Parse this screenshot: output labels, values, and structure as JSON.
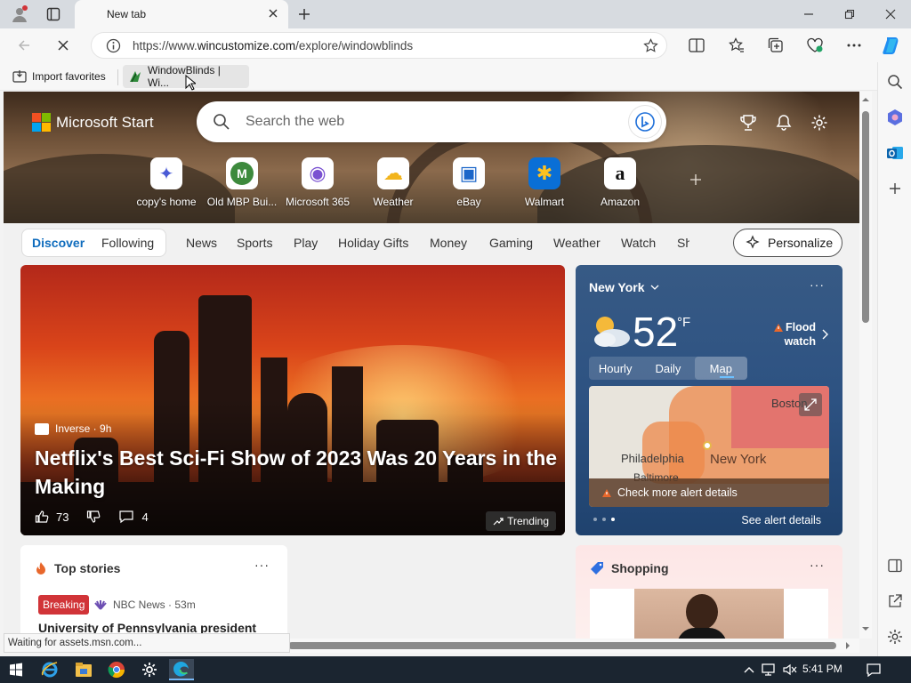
{
  "window": {
    "tab_title": "New tab"
  },
  "toolbar": {
    "url_prefix": "https://www.",
    "url_host": "wincustomize.com",
    "url_path": "/explore/windowblinds"
  },
  "favorites": [
    {
      "label": "Import favorites"
    },
    {
      "label": "WindowBlinds | Wi..."
    }
  ],
  "hero": {
    "brand": "Microsoft Start",
    "search_placeholder": "Search the web",
    "quick_links": [
      {
        "label": "copy's home",
        "color": "#4a5bd6",
        "glyph": "✦"
      },
      {
        "label": "Old MBP Bui...",
        "color": "#3d8a3d",
        "glyph": "M"
      },
      {
        "label": "Microsoft 365",
        "color": "#7a52d1",
        "glyph": "◉"
      },
      {
        "label": "Weather",
        "color": "#f2b41c",
        "glyph": "☁"
      },
      {
        "label": "eBay",
        "color": "#1b66c9",
        "glyph": "▣"
      },
      {
        "label": "Walmart",
        "color": "#0a6fd6",
        "glyph": "✱"
      },
      {
        "label": "Amazon",
        "color": "#111111",
        "glyph": "a"
      }
    ]
  },
  "nav": {
    "tabs_left": [
      "Discover",
      "Following"
    ],
    "tabs": [
      "News",
      "Sports",
      "Play",
      "Holiday Gifts",
      "Money",
      "Gaming",
      "Weather",
      "Watch",
      "Sh"
    ],
    "personalize": "Personalize"
  },
  "story": {
    "source": "Inverse · 9h",
    "headline": "Netflix's Best Sci-Fi Show of 2023 Was 20 Years in the Making",
    "likes": "73",
    "comments": "4",
    "trending": "Trending"
  },
  "weather": {
    "location": "New York",
    "temp": "52",
    "unit": "°F",
    "alert_line1": "Flood",
    "alert_line2": "watch",
    "tabs": [
      "Hourly",
      "Daily",
      "Map"
    ],
    "map_labels": [
      "Boston",
      "Philadelphia",
      "New York",
      "Baltimore"
    ],
    "map_alert": "Check more alert details",
    "see_details": "See alert details"
  },
  "top_stories": {
    "title": "Top stories",
    "badge": "Breaking",
    "source": "NBC News · 53m",
    "headline": "University of Pennsylvania president"
  },
  "shopping": {
    "title": "Shopping"
  },
  "status": "Waiting for assets.msn.com...",
  "taskbar": {
    "time": "5:41 PM"
  },
  "colors": {
    "accent": "#0f6cbd",
    "hero_brown": "#6e5138",
    "weather_blue": "#2d5282",
    "breaking_red": "#d13438"
  }
}
